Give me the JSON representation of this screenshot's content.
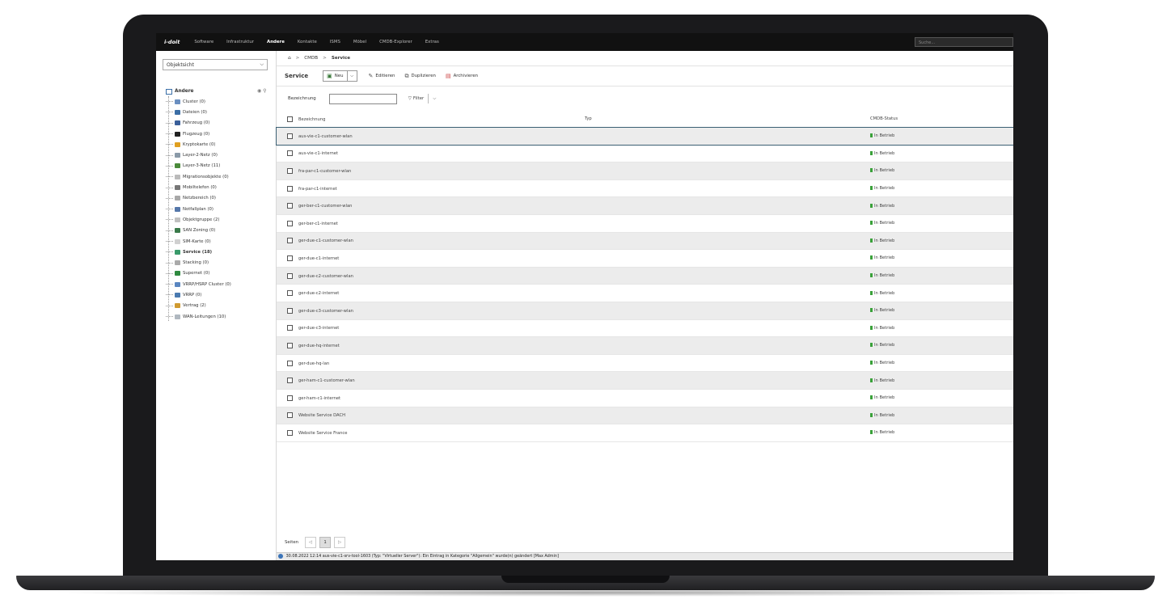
{
  "nav": {
    "logo": "i-doit",
    "items": [
      "Software",
      "Infrastruktur",
      "Andere",
      "Kontakte",
      "ISMS",
      "Möbel",
      "CMDB-Explorer",
      "Extras"
    ],
    "active": "Andere",
    "search_placeholder": "Suche..."
  },
  "sidebar": {
    "view_select": "Objektsicht",
    "root": "Andere",
    "items": [
      {
        "label": "Cluster (0)",
        "color": "#6a8fc0"
      },
      {
        "label": "Dateien (0)",
        "color": "#3b6ea5"
      },
      {
        "label": "Fahrzeug (0)",
        "color": "#3a5f9a"
      },
      {
        "label": "Flugzeug (0)",
        "color": "#222222"
      },
      {
        "label": "Kryptokarte (0)",
        "color": "#e0a020"
      },
      {
        "label": "Layer-2-Netz (0)",
        "color": "#8a9aa8"
      },
      {
        "label": "Layer-3-Netz (11)",
        "color": "#4a8a3a"
      },
      {
        "label": "Migrationsobjekte (0)",
        "color": "#bbbbbb"
      },
      {
        "label": "Mobiltelefon (0)",
        "color": "#777777"
      },
      {
        "label": "Netzbereich (0)",
        "color": "#a8a8a8"
      },
      {
        "label": "Notfallplan (0)",
        "color": "#5577aa"
      },
      {
        "label": "Objektgruppe (2)",
        "color": "#c0c0c0"
      },
      {
        "label": "SAN Zoning (0)",
        "color": "#3a7a4a"
      },
      {
        "label": "SIM-Karte (0)",
        "color": "#d0d0d0"
      },
      {
        "label": "Service (18)",
        "color": "#3a9a6a",
        "bold": true
      },
      {
        "label": "Stacking (0)",
        "color": "#aaaaaa"
      },
      {
        "label": "Supernet (0)",
        "color": "#2f8a40"
      },
      {
        "label": "VRRP/HSRP Cluster (0)",
        "color": "#5a86c0"
      },
      {
        "label": "VRRP (0)",
        "color": "#4a7ab0"
      },
      {
        "label": "Vertrag (2)",
        "color": "#d09a30"
      },
      {
        "label": "WAN-Leitungen (10)",
        "color": "#b0b8c0"
      }
    ]
  },
  "breadcrumb": {
    "home": "⌂",
    "items": [
      "CMDB",
      "Service"
    ]
  },
  "toolbar": {
    "title": "Service",
    "new_label": "Neu",
    "edit_label": "Editieren",
    "duplicate_label": "Duplizieren",
    "archive_label": "Archivieren"
  },
  "filter": {
    "label": "Bezeichnung",
    "button": "Filter"
  },
  "table": {
    "headers": [
      "Bezeichnung",
      "Typ",
      "CMDB-Status"
    ],
    "rows": [
      {
        "name": "aus-vie-c1-customer-wlan",
        "typ": "",
        "status": "In Betrieb"
      },
      {
        "name": "aus-vie-c1-internet",
        "typ": "",
        "status": "In Betrieb"
      },
      {
        "name": "fra-par-c1-customer-wlan",
        "typ": "",
        "status": "In Betrieb"
      },
      {
        "name": "fra-par-c1-internet",
        "typ": "",
        "status": "In Betrieb"
      },
      {
        "name": "ger-ber-c1-customer-wlan",
        "typ": "",
        "status": "In Betrieb"
      },
      {
        "name": "ger-ber-c1-internet",
        "typ": "",
        "status": "In Betrieb"
      },
      {
        "name": "ger-due-c1-customer-wlan",
        "typ": "",
        "status": "In Betrieb"
      },
      {
        "name": "ger-due-c1-internet",
        "typ": "",
        "status": "In Betrieb"
      },
      {
        "name": "ger-due-c2-customer-wlan",
        "typ": "",
        "status": "In Betrieb"
      },
      {
        "name": "ger-due-c2-internet",
        "typ": "",
        "status": "In Betrieb"
      },
      {
        "name": "ger-due-c3-customer-wlan",
        "typ": "",
        "status": "In Betrieb"
      },
      {
        "name": "ger-due-c3-internet",
        "typ": "",
        "status": "In Betrieb"
      },
      {
        "name": "ger-due-hq-internet",
        "typ": "",
        "status": "In Betrieb"
      },
      {
        "name": "ger-due-hq-lan",
        "typ": "",
        "status": "In Betrieb"
      },
      {
        "name": "ger-ham-c1-customer-wlan",
        "typ": "",
        "status": "In Betrieb"
      },
      {
        "name": "ger-ham-c1-internet",
        "typ": "",
        "status": "In Betrieb"
      },
      {
        "name": "Website Service DACH",
        "typ": "",
        "status": "In Betrieb"
      },
      {
        "name": "Website Service France",
        "typ": "",
        "status": "In Betrieb"
      }
    ],
    "selected_index": 0
  },
  "pager": {
    "label": "Seiten",
    "prev": "◁",
    "current": "1",
    "next": "▷"
  },
  "statusbar": "30.08.2022 12:14 aus-vie-c1-srv-tool-1603 (Typ: \"Virtueller Server\"): Ein Eintrag in Kategorie \"Allgemein\" wurde(n) geändert [Max Admin]",
  "colors": {
    "status_ok": "#3aa13a",
    "nav_bg": "#111111",
    "selection": "#3b5f73"
  }
}
